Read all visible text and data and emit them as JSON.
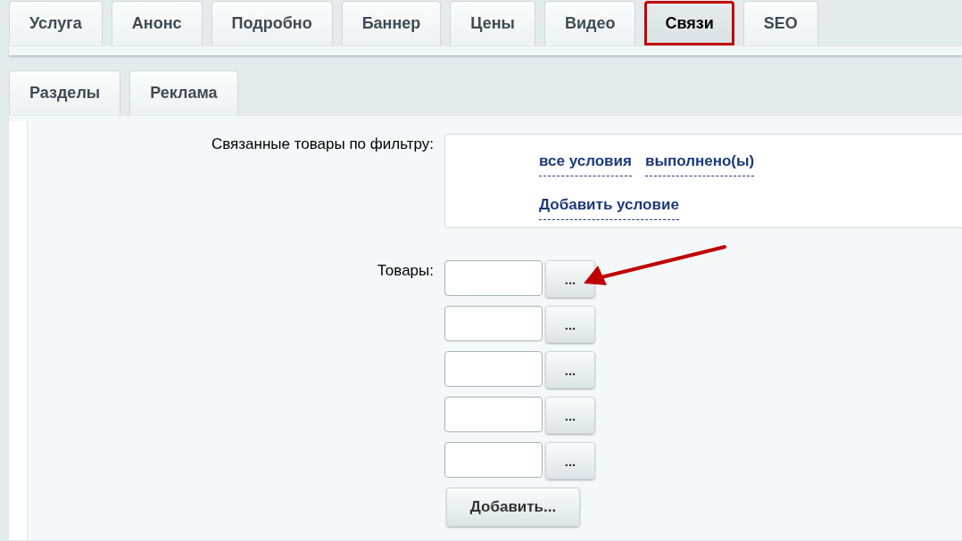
{
  "tabs": [
    {
      "label": "Услуга",
      "selected": false,
      "highlighted": false
    },
    {
      "label": "Анонс",
      "selected": false,
      "highlighted": false
    },
    {
      "label": "Подробно",
      "selected": false,
      "highlighted": false
    },
    {
      "label": "Баннер",
      "selected": false,
      "highlighted": false
    },
    {
      "label": "Цены",
      "selected": false,
      "highlighted": false
    },
    {
      "label": "Видео",
      "selected": false,
      "highlighted": false
    },
    {
      "label": "Связи",
      "selected": true,
      "highlighted": true
    },
    {
      "label": "SEO",
      "selected": false,
      "highlighted": false
    }
  ],
  "subtabs": [
    {
      "label": "Разделы",
      "selected": false
    },
    {
      "label": "Реклама",
      "selected": false
    }
  ],
  "filter": {
    "label": "Связанные товары по фильтру:",
    "links": [
      "все условия",
      "выполнено(ы)"
    ],
    "add_condition": "Добавить условие"
  },
  "products": {
    "label": "Товары:",
    "rows": [
      {
        "value": "",
        "button": "..."
      },
      {
        "value": "",
        "button": "..."
      },
      {
        "value": "",
        "button": "..."
      },
      {
        "value": "",
        "button": "..."
      },
      {
        "value": "",
        "button": "..."
      }
    ],
    "add_button": "Добавить..."
  },
  "annotation": {
    "kind": "arrow"
  }
}
